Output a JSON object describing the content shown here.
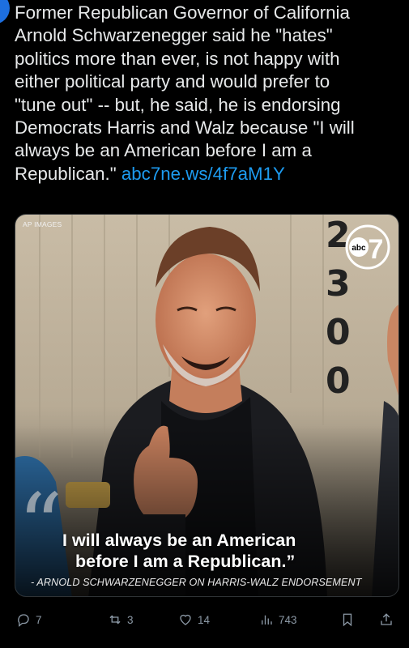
{
  "tweet": {
    "text": "Former Republican Governor of California\nArnold Schwarzenegger said he \"hates\"\npolitics more than ever, is not happy with\neither political party and would prefer to\n\"tune out\" -- but, he said, he is endorsing\nDemocrats Harris and Walz because \"I will\nalways be an American before I am a\nRepublican.\" ",
    "link": "abc7ne.ws/4f7aM1Y"
  },
  "media": {
    "credit": "AP IMAGES",
    "logo_text": "abc",
    "logo_number": "7",
    "quote_line1": "I will always be an American",
    "quote_line2": "before I am a Republican.”",
    "attribution": "- ARNOLD SCHWARZENEGGER ON HARRIS-WALZ ENDORSEMENT"
  },
  "actions": {
    "replies": "7",
    "reposts": "3",
    "likes": "14",
    "views": "743"
  },
  "colors": {
    "link": "#1d9bf0",
    "action_gray": "#8b98a5",
    "background": "#000000"
  }
}
